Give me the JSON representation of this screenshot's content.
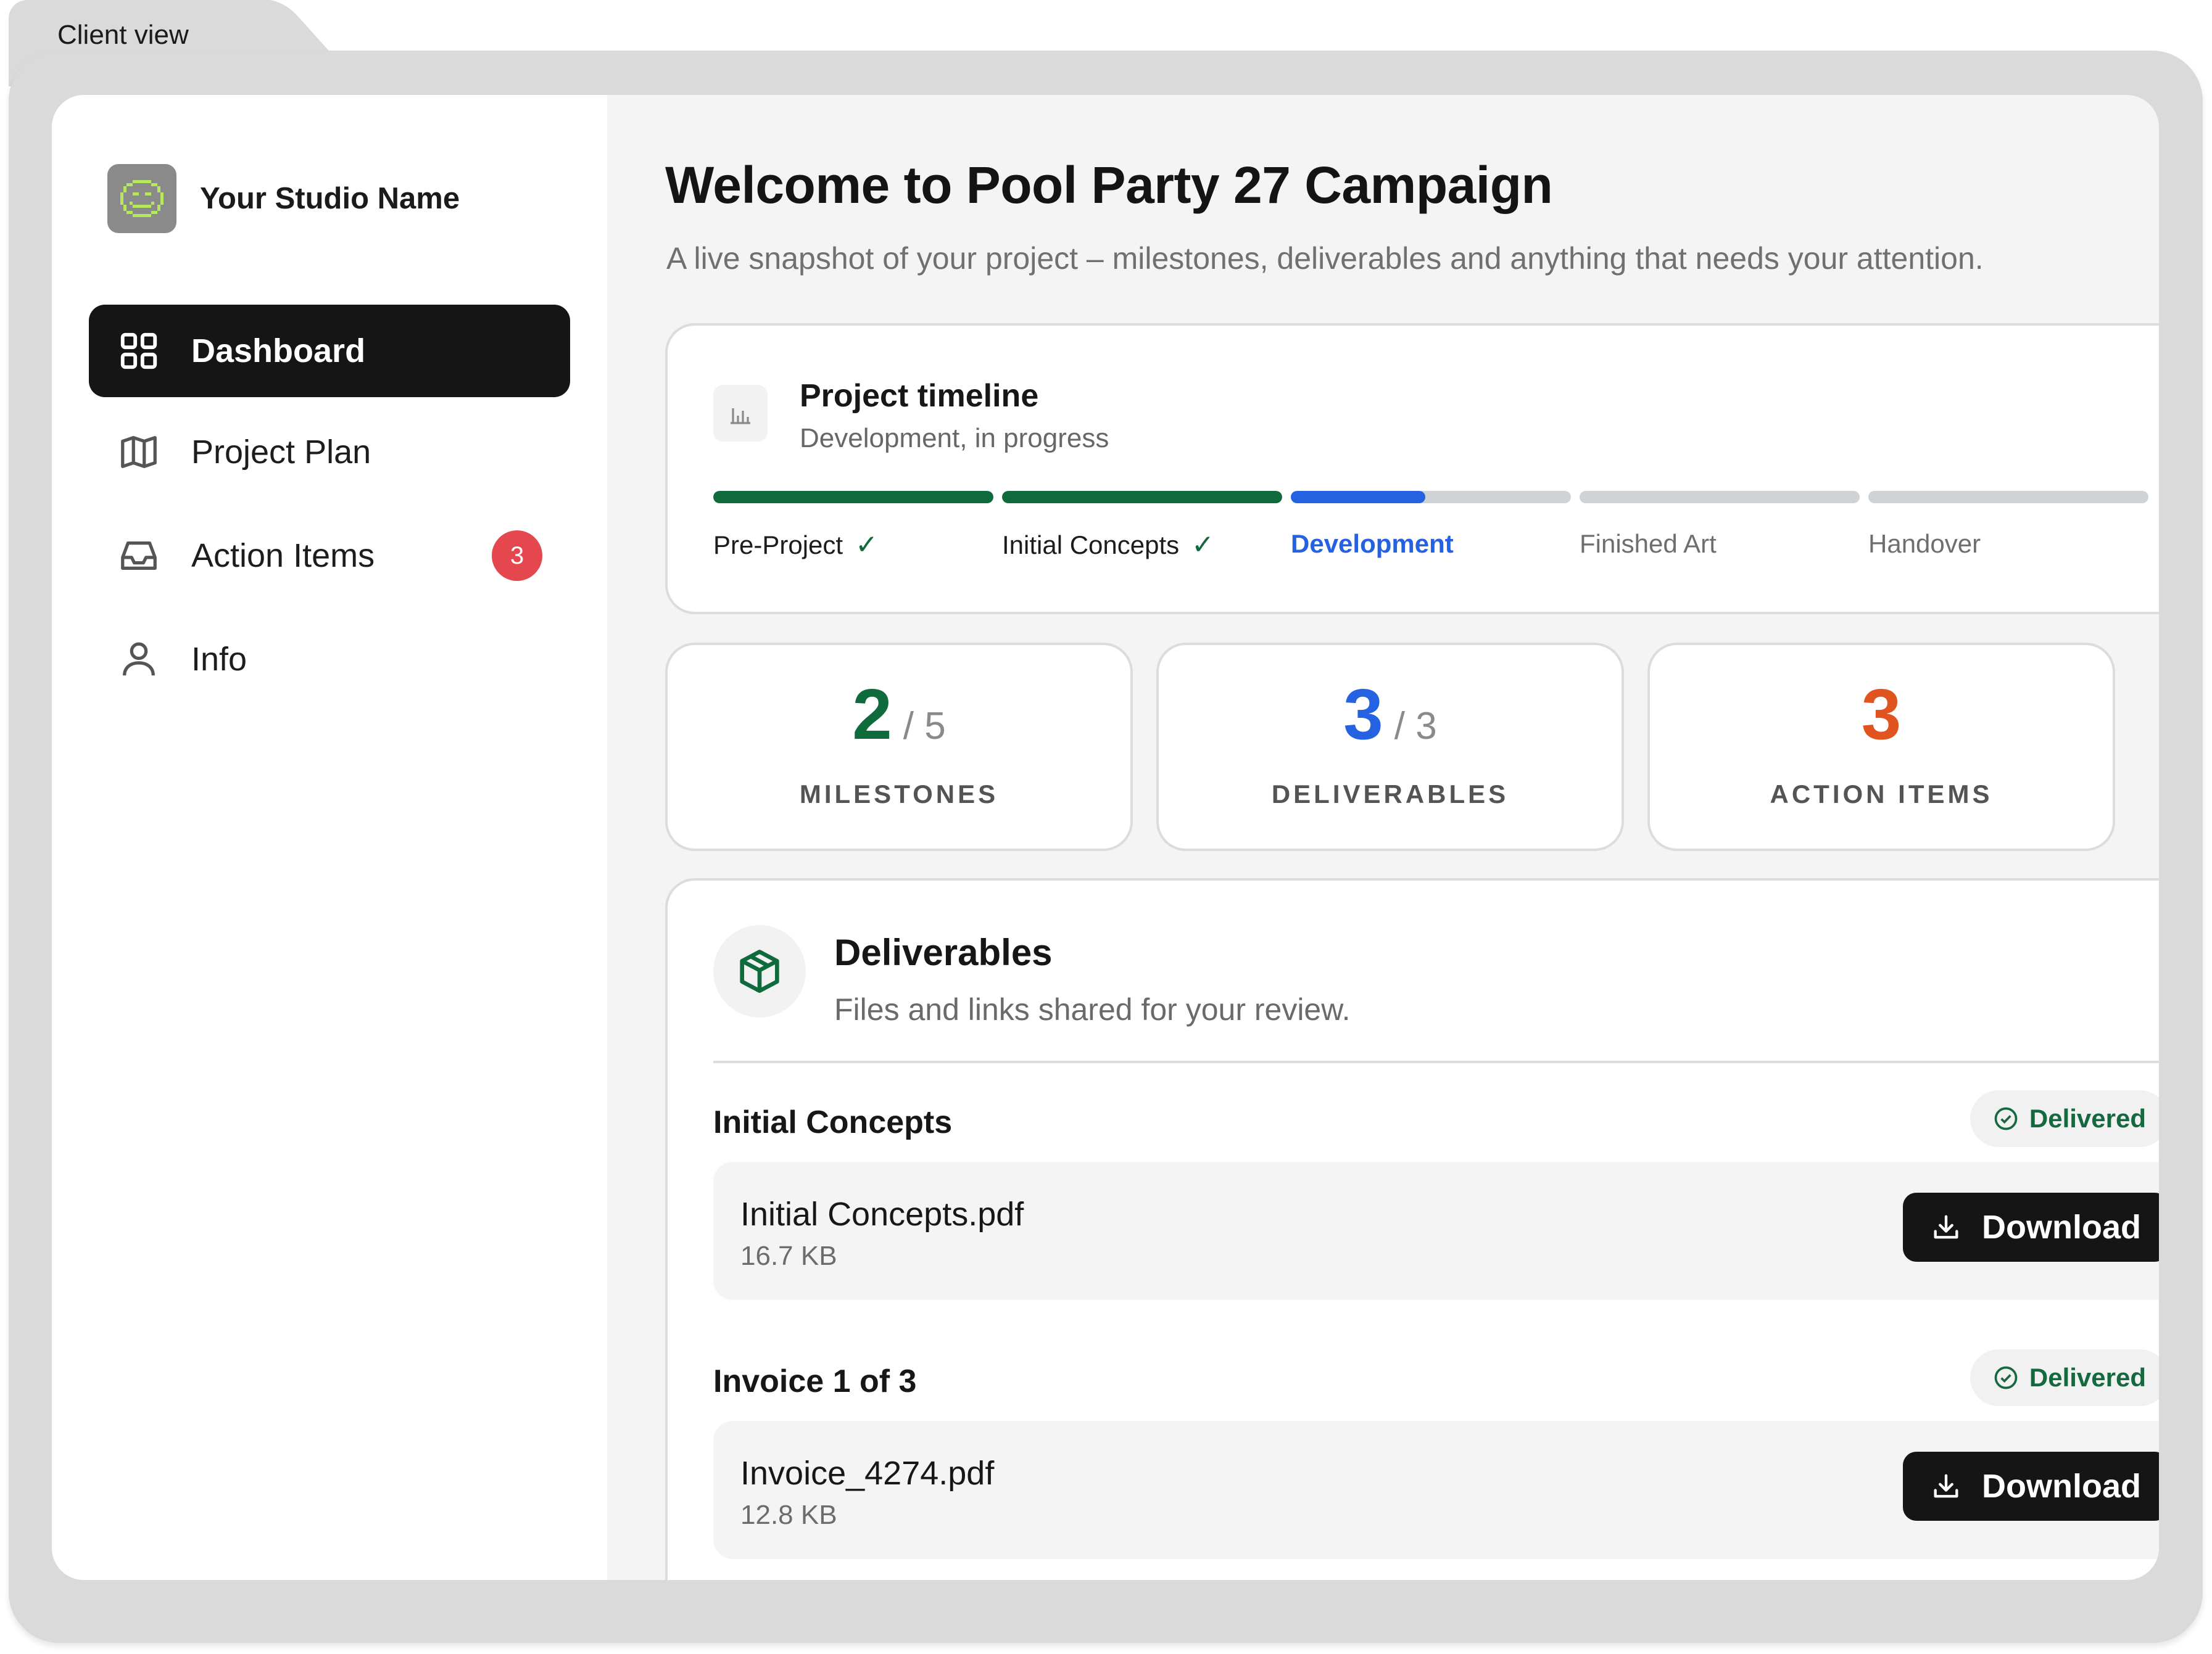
{
  "folder": {
    "label": "Client view"
  },
  "sidebar": {
    "studio_name": "Your Studio Name",
    "items": [
      {
        "label": "Dashboard",
        "icon": "grid-icon",
        "active": true
      },
      {
        "label": "Project Plan",
        "icon": "map-icon"
      },
      {
        "label": "Action Items",
        "icon": "inbox-icon",
        "badge": "3"
      },
      {
        "label": "Info",
        "icon": "user-icon"
      }
    ]
  },
  "main": {
    "title": "Welcome to Pool Party 27 Campaign",
    "subtitle": "A live snapshot of your project – milestones, deliverables and anything that needs your attention."
  },
  "timeline": {
    "title": "Project timeline",
    "subtitle": "Development, in progress",
    "stages": [
      {
        "label": "Pre-Project",
        "status": "complete",
        "progress": 1.0
      },
      {
        "label": "Initial Concepts",
        "status": "complete",
        "progress": 1.0
      },
      {
        "label": "Development",
        "status": "current",
        "progress": 0.48
      },
      {
        "label": "Finished Art",
        "status": "upcoming",
        "progress": 0
      },
      {
        "label": "Handover",
        "status": "upcoming",
        "progress": 0
      }
    ],
    "colors": {
      "complete": "#0f6a3c",
      "current": "#2462e1",
      "upcoming": "#cfd3d6"
    }
  },
  "stats": {
    "milestones": {
      "value": "2",
      "total": "/ 5",
      "label": "MILESTONES",
      "color": "#0f6a3c"
    },
    "deliverables": {
      "value": "3",
      "total": "/ 3",
      "label": "DELIVERABLES",
      "color": "#2462e1"
    },
    "action_items": {
      "value": "3",
      "label": "ACTION ITEMS",
      "color": "#e1531f"
    }
  },
  "deliverables": {
    "title": "Deliverables",
    "subtitle": "Files and links shared for your review.",
    "groups": [
      {
        "title": "Initial Concepts",
        "status": "Delivered",
        "file_name": "Initial Concepts.pdf",
        "file_size": "16.7 KB",
        "button": "Download"
      },
      {
        "title": "Invoice 1 of 3",
        "status": "Delivered",
        "file_name": "Invoice_4274.pdf",
        "file_size": "12.8 KB",
        "button": "Download"
      }
    ]
  }
}
